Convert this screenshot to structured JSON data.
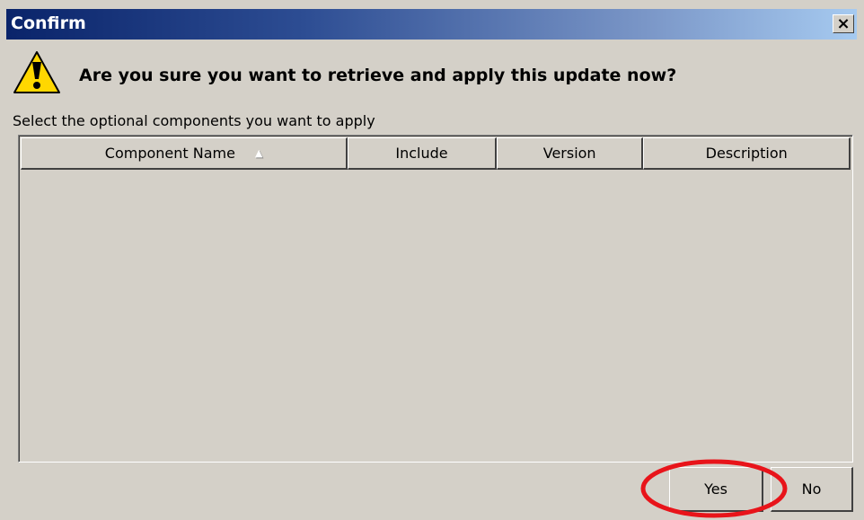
{
  "window": {
    "title": "Confirm",
    "close_glyph": "×"
  },
  "dialog": {
    "icon": "warning-icon",
    "prompt": "Are you sure you want to retrieve and apply this update now?",
    "instruction": "Select the optional components you want to apply"
  },
  "table": {
    "columns": [
      "Component Name",
      "Include",
      "Version",
      "Description"
    ],
    "sort_indicator": "▲",
    "rows": []
  },
  "buttons": {
    "yes": "Yes",
    "no": "No"
  },
  "annotation": {
    "highlight_color": "#e8141a"
  },
  "colors": {
    "dialog_bg": "#d4d0c8",
    "title_gradient_start": "#0a246a",
    "title_gradient_end": "#a6caf0",
    "warning_yellow": "#ffd700"
  }
}
